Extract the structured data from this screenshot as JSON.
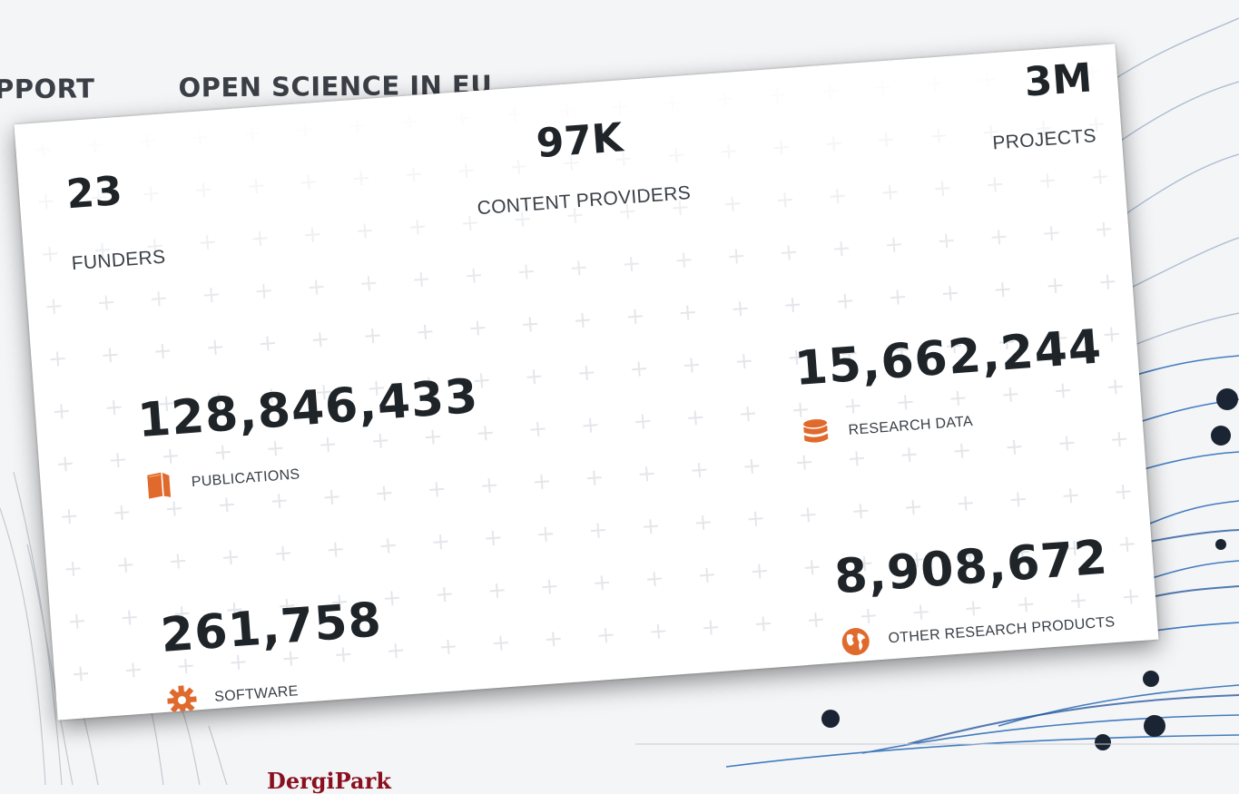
{
  "nav": {
    "items": [
      "PPORT",
      "OPEN SCIENCE IN EU"
    ]
  },
  "footer": {
    "logo_text": "DergiPark"
  },
  "stats": {
    "funders": {
      "value": "23",
      "label": "FUNDERS"
    },
    "content_providers": {
      "value": "97K",
      "label": "CONTENT PROVIDERS"
    },
    "projects": {
      "value": "3M",
      "label": "PROJECTS"
    },
    "publications": {
      "value": "128,846,433",
      "label": "PUBLICATIONS",
      "icon": "book-icon"
    },
    "research_data": {
      "value": "15,662,244",
      "label": "RESEARCH DATA",
      "icon": "database-icon"
    },
    "software": {
      "value": "261,758",
      "label": "SOFTWARE",
      "icon": "gear-icon"
    },
    "other_research_products": {
      "value": "8,908,672",
      "label": "OTHER RESEARCH PRODUCTS",
      "icon": "globe-icon"
    }
  },
  "colors": {
    "accent": "#e06a2c",
    "text_dark": "#1f2429",
    "card_bg": "#ffffff",
    "logo": "#8a1020"
  }
}
